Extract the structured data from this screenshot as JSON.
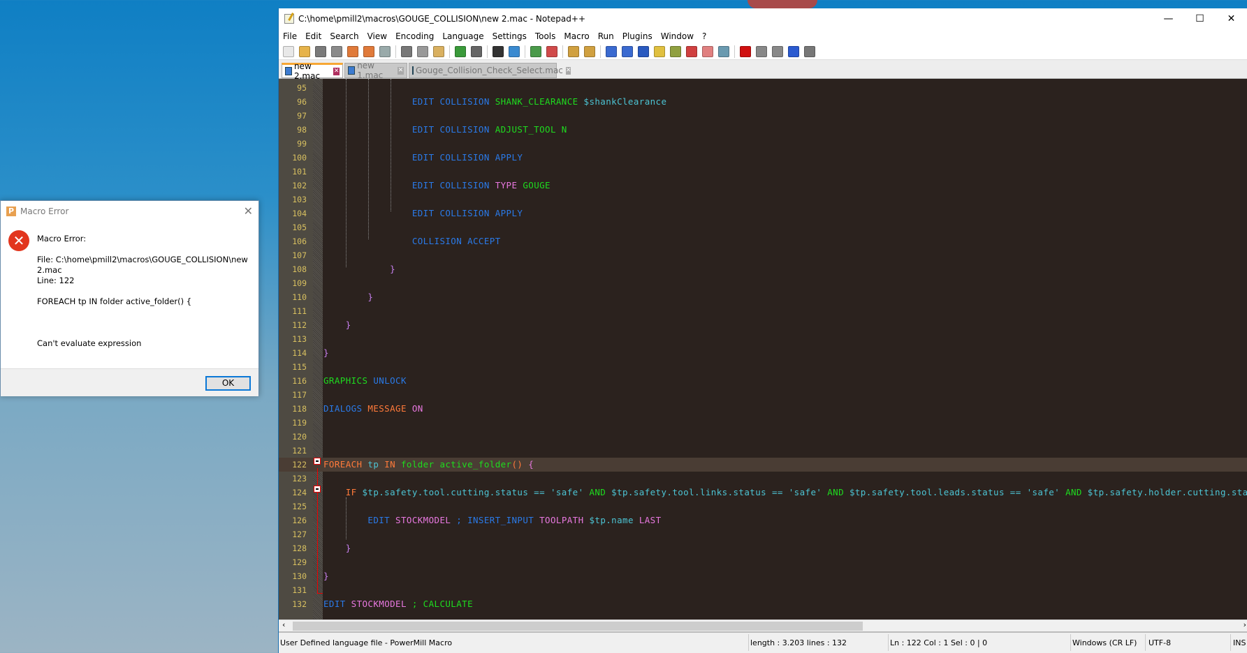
{
  "window": {
    "title": "C:\\home\\pmill2\\macros\\GOUGE_COLLISION\\new 2.mac - Notepad++",
    "minimize": "—",
    "maximize": "☐",
    "close": "✕"
  },
  "menu": [
    "File",
    "Edit",
    "Search",
    "View",
    "Encoding",
    "Language",
    "Settings",
    "Tools",
    "Macro",
    "Run",
    "Plugins",
    "Window",
    "?"
  ],
  "toolbar_icons": [
    {
      "name": "new-file-icon",
      "color": "#e8e8e8"
    },
    {
      "name": "open-file-icon",
      "color": "#e6b34a"
    },
    {
      "name": "save-icon",
      "color": "#7a7a7a"
    },
    {
      "name": "save-all-icon",
      "color": "#8a8a8a"
    },
    {
      "name": "close-icon",
      "color": "#e07a3a"
    },
    {
      "name": "close-all-icon",
      "color": "#e07a3a"
    },
    {
      "name": "print-icon",
      "color": "#9aa"
    },
    null,
    {
      "name": "cut-icon",
      "color": "#777"
    },
    {
      "name": "copy-icon",
      "color": "#999"
    },
    {
      "name": "paste-icon",
      "color": "#d9b060"
    },
    null,
    {
      "name": "undo-icon",
      "color": "#3a9a3a"
    },
    {
      "name": "redo-icon",
      "color": "#666"
    },
    null,
    {
      "name": "find-icon",
      "color": "#333"
    },
    {
      "name": "replace-icon",
      "color": "#3a8ad0"
    },
    null,
    {
      "name": "zoom-in-icon",
      "color": "#4a9a4a"
    },
    {
      "name": "zoom-out-icon",
      "color": "#d04a4a"
    },
    null,
    {
      "name": "sync-vertical-icon",
      "color": "#d0a040"
    },
    {
      "name": "sync-horizontal-icon",
      "color": "#d0a040"
    },
    null,
    {
      "name": "word-wrap-icon",
      "color": "#3a6ad0"
    },
    {
      "name": "show-all-chars-icon",
      "color": "#3a6ad0"
    },
    {
      "name": "indent-guide-icon",
      "color": "#2a5ac0"
    },
    {
      "name": "doc-map-icon",
      "color": "#e0c040"
    },
    {
      "name": "function-list-icon",
      "color": "#90a040"
    },
    {
      "name": "folder-workspace-icon",
      "color": "#d04040"
    },
    {
      "name": "monitoring-icon",
      "color": "#e08080"
    },
    {
      "name": "eye-icon",
      "color": "#6a9ab0"
    },
    null,
    {
      "name": "record-macro-icon",
      "color": "#d01010"
    },
    {
      "name": "stop-record-icon",
      "color": "#888"
    },
    {
      "name": "play-macro-icon",
      "color": "#888"
    },
    {
      "name": "run-macro-multiple-icon",
      "color": "#2a5ad0"
    },
    {
      "name": "save-macro-icon",
      "color": "#777"
    }
  ],
  "tabs": [
    {
      "label": "new 2.mac",
      "active": true
    },
    {
      "label": "new 1.mac",
      "active": false
    },
    {
      "label": "Gouge_Collision_Check_Select.mac",
      "active": false
    }
  ],
  "colors": {
    "blue": "#2a7ae8",
    "green": "#1edc1e",
    "teal": "#4cc4d4",
    "pink": "#e878e0",
    "orange": "#ff7a3a",
    "brace": "#c880f0",
    "linenum": "#d8c060"
  },
  "code": [
    {
      "n": "95",
      "t": []
    },
    {
      "n": "96",
      "t": [
        [
          "                ",
          ""
        ],
        [
          "EDIT COLLISION ",
          "blue"
        ],
        [
          "SHANK_CLEARANCE ",
          "green"
        ],
        [
          "$shankClearance",
          "teal"
        ]
      ]
    },
    {
      "n": "97",
      "t": []
    },
    {
      "n": "98",
      "t": [
        [
          "                ",
          ""
        ],
        [
          "EDIT COLLISION ",
          "blue"
        ],
        [
          "ADJUST_TOOL N",
          "green"
        ]
      ]
    },
    {
      "n": "99",
      "t": []
    },
    {
      "n": "100",
      "t": [
        [
          "                ",
          ""
        ],
        [
          "EDIT COLLISION APPLY",
          "blue"
        ]
      ]
    },
    {
      "n": "101",
      "t": []
    },
    {
      "n": "102",
      "t": [
        [
          "                ",
          ""
        ],
        [
          "EDIT COLLISION ",
          "blue"
        ],
        [
          "TYPE ",
          "pink"
        ],
        [
          "GOUGE",
          "green"
        ]
      ]
    },
    {
      "n": "103",
      "t": []
    },
    {
      "n": "104",
      "t": [
        [
          "                ",
          ""
        ],
        [
          "EDIT COLLISION APPLY",
          "blue"
        ]
      ]
    },
    {
      "n": "105",
      "t": []
    },
    {
      "n": "106",
      "t": [
        [
          "                ",
          ""
        ],
        [
          "COLLISION ACCEPT",
          "blue"
        ]
      ]
    },
    {
      "n": "107",
      "t": []
    },
    {
      "n": "108",
      "t": [
        [
          "            ",
          ""
        ],
        [
          "}",
          "brace"
        ]
      ]
    },
    {
      "n": "109",
      "t": []
    },
    {
      "n": "110",
      "t": [
        [
          "        ",
          ""
        ],
        [
          "}",
          "brace"
        ]
      ]
    },
    {
      "n": "111",
      "t": []
    },
    {
      "n": "112",
      "t": [
        [
          "    ",
          ""
        ],
        [
          "}",
          "brace"
        ]
      ]
    },
    {
      "n": "113",
      "t": []
    },
    {
      "n": "114",
      "t": [
        [
          "}",
          "brace"
        ]
      ]
    },
    {
      "n": "115",
      "t": []
    },
    {
      "n": "116",
      "t": [
        [
          "GRAPHICS ",
          "green"
        ],
        [
          "UNLOCK",
          "blue"
        ]
      ]
    },
    {
      "n": "117",
      "t": []
    },
    {
      "n": "118",
      "t": [
        [
          "DIALOGS ",
          "blue"
        ],
        [
          "MESSAGE ",
          "orange"
        ],
        [
          "ON",
          "pink"
        ]
      ]
    },
    {
      "n": "119",
      "t": []
    },
    {
      "n": "120",
      "t": []
    },
    {
      "n": "121",
      "t": []
    },
    {
      "n": "122",
      "t": [
        [
          "FOREACH ",
          "orange"
        ],
        [
          "tp ",
          "teal"
        ],
        [
          "IN ",
          "orange"
        ],
        [
          "folder active_folder",
          "green"
        ],
        [
          "() ",
          "orange"
        ],
        [
          "{",
          "pink"
        ]
      ],
      "current": true
    },
    {
      "n": "123",
      "t": []
    },
    {
      "n": "124",
      "t": [
        [
          "    ",
          ""
        ],
        [
          "IF ",
          "orange"
        ],
        [
          "$tp.safety.tool.cutting.status == 'safe' ",
          "teal"
        ],
        [
          "AND ",
          "green"
        ],
        [
          "$tp.safety.tool.links.status == 'safe' ",
          "teal"
        ],
        [
          "AND ",
          "green"
        ],
        [
          "$tp.safety.tool.leads.status == 'safe' ",
          "teal"
        ],
        [
          "AND ",
          "green"
        ],
        [
          "$tp.safety.holder.cutting.status == 'safe'",
          "teal"
        ]
      ]
    },
    {
      "n": "125",
      "t": []
    },
    {
      "n": "126",
      "t": [
        [
          "        ",
          ""
        ],
        [
          "EDIT ",
          "blue"
        ],
        [
          "STOCKMODEL ",
          "pink"
        ],
        [
          "; INSERT_INPUT ",
          "blue"
        ],
        [
          "TOOLPATH ",
          "pink"
        ],
        [
          "$tp.name ",
          "teal"
        ],
        [
          "LAST",
          "pink"
        ]
      ]
    },
    {
      "n": "127",
      "t": []
    },
    {
      "n": "128",
      "t": [
        [
          "    ",
          ""
        ],
        [
          "}",
          "brace"
        ]
      ]
    },
    {
      "n": "129",
      "t": []
    },
    {
      "n": "130",
      "t": [
        [
          "}",
          "brace"
        ]
      ]
    },
    {
      "n": "131",
      "t": []
    },
    {
      "n": "132",
      "t": [
        [
          "EDIT ",
          "blue"
        ],
        [
          "STOCKMODEL ",
          "pink"
        ],
        [
          "; CALCULATE",
          "green"
        ]
      ]
    }
  ],
  "status": {
    "lang": "User Defined language file - PowerMill Macro",
    "length": "length : 3.203    lines : 132",
    "pos": "Ln : 122    Col : 1    Sel : 0 | 0",
    "eol": "Windows (CR LF)",
    "enc": "UTF-8",
    "mode": "INS"
  },
  "dialog": {
    "title": "Macro Error",
    "heading": "Macro Error:",
    "file_line1": "File: C:\\home\\pmill2\\macros\\GOUGE_COLLISION\\new",
    "file_line2": "2.mac",
    "line": "Line: 122",
    "statement": "FOREACH tp IN folder active_folder() {",
    "message": "Can't evaluate expression",
    "ok": "OK"
  }
}
